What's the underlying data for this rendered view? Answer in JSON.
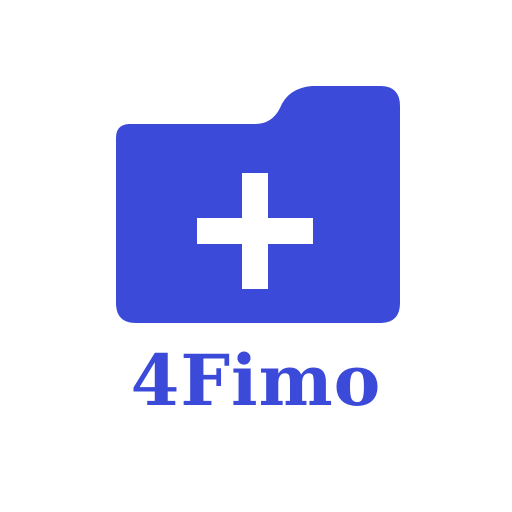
{
  "logo": {
    "brand_name": "4Fimo",
    "icon": "folder-plus-icon",
    "colors": {
      "primary": "#3b4ad9",
      "background": "#ffffff",
      "glyph": "#ffffff"
    }
  }
}
